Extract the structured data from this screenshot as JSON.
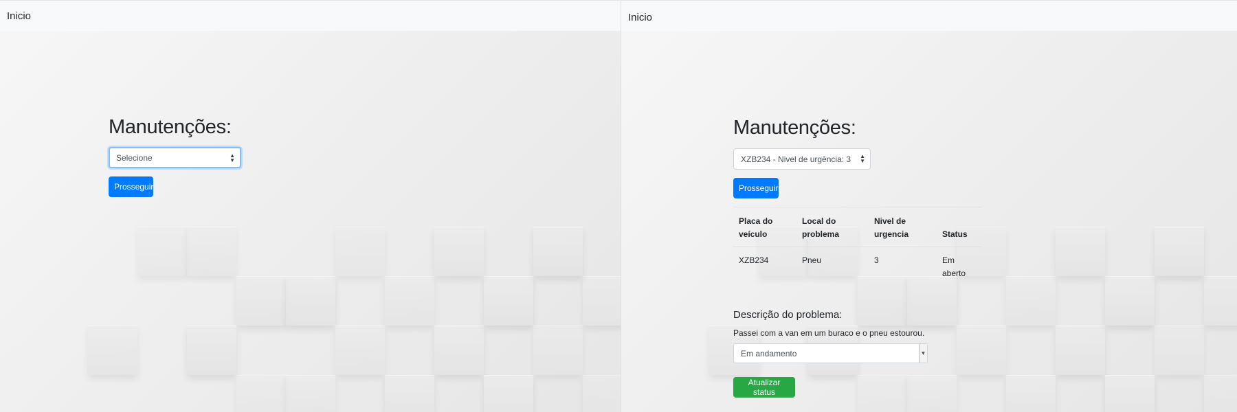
{
  "left_panel": {
    "nav": {
      "home_label": "Inicio"
    },
    "heading": "Manutenções:",
    "vehicle_select": {
      "selected": "Selecione"
    },
    "proceed_button": "Prosseguir"
  },
  "right_panel": {
    "nav": {
      "home_label": "Inicio"
    },
    "heading": "Manutenções:",
    "vehicle_select": {
      "selected": "XZB234 - Nivel de urgência: 3"
    },
    "proceed_button": "Prosseguir",
    "table": {
      "headers": {
        "plate": [
          "Placa do",
          "veículo"
        ],
        "location": [
          "Local do",
          "problema"
        ],
        "urgency": [
          "Nivel de",
          "urgencia"
        ],
        "status": [
          "Status"
        ]
      },
      "row": {
        "plate": "XZB234",
        "location": "Pneu",
        "urgency": "3",
        "status": [
          "Em",
          "aberto"
        ]
      }
    },
    "description_label": "Descrição do problema:",
    "description_text": "Passei com a van em um buraco e o pneu estourou.",
    "status_select": {
      "selected": "Em andamento"
    },
    "update_button": "Atualizar status"
  },
  "colors": {
    "primary": "#007bff",
    "success": "#28a745",
    "navbar": "#f8f9fa"
  },
  "icons": {
    "select_arrow": "sort-arrows-icon",
    "dropdown_arrow": "chevron-down-icon"
  }
}
